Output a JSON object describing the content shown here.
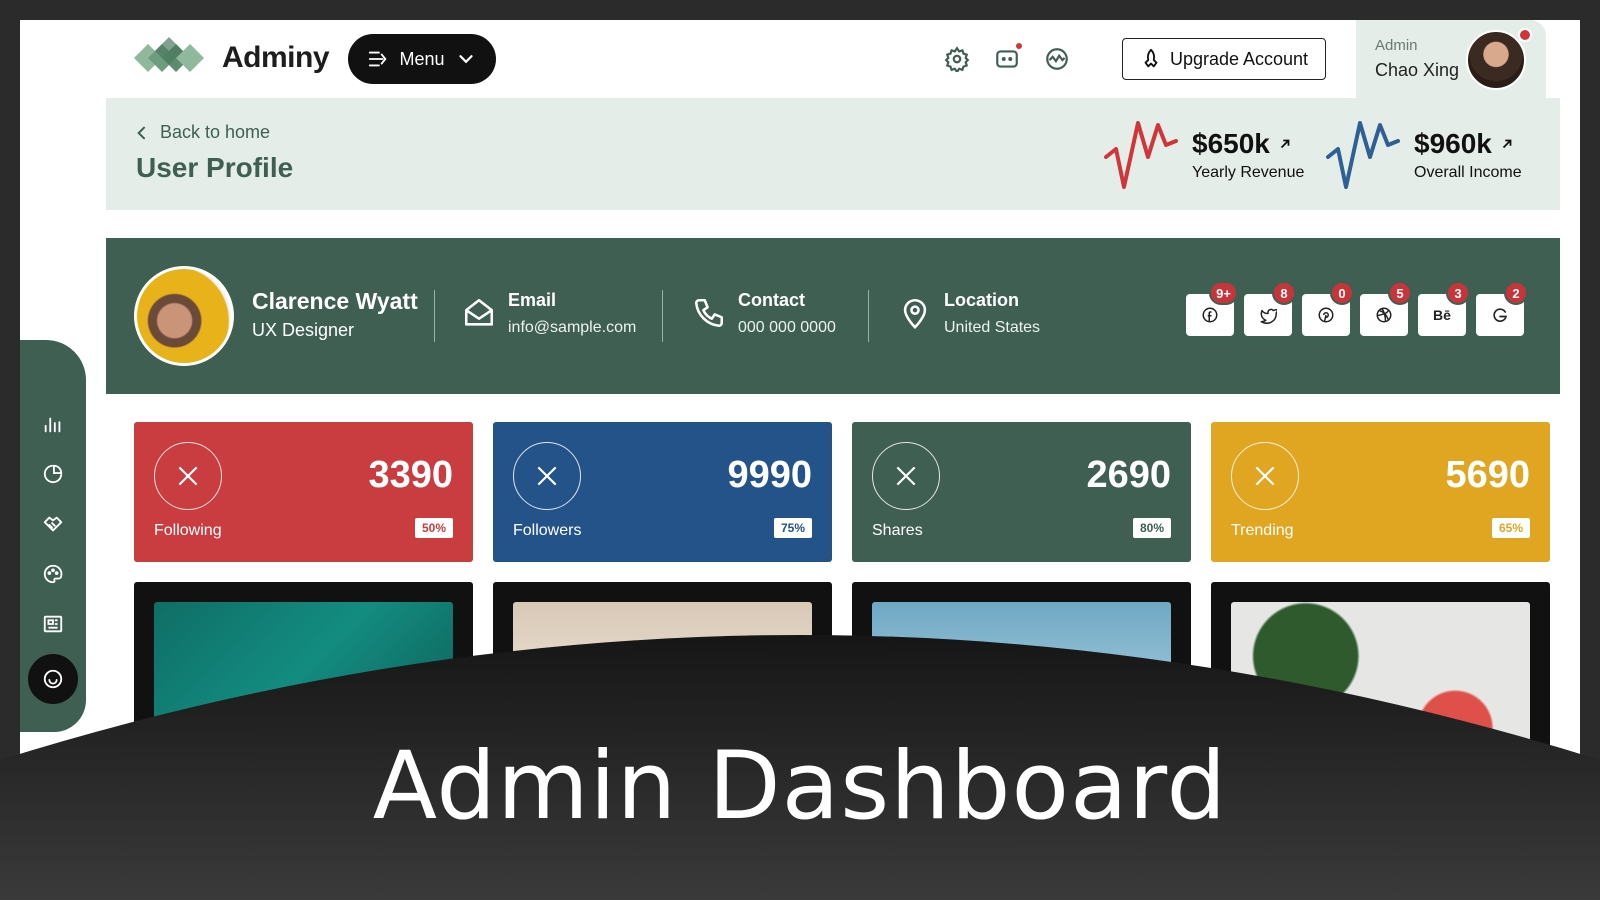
{
  "header": {
    "logo_text": "Adminy",
    "menu_label": "Menu",
    "upgrade_label": "Upgrade Account",
    "user": {
      "role": "Admin",
      "name": "Chao Xing"
    }
  },
  "subheader": {
    "back_label": "Back to home",
    "title": "User Profile",
    "stats": [
      {
        "value": "$650k",
        "label": "Yearly Revenue",
        "color": "#d0353a"
      },
      {
        "value": "$960k",
        "label": "Overall Income",
        "color": "#2e5f95"
      }
    ]
  },
  "profile": {
    "name": "Clarence Wyatt",
    "role": "UX Designer",
    "email": {
      "title": "Email",
      "value": "info@sample.com"
    },
    "contact": {
      "title": "Contact",
      "value": "000 000 0000"
    },
    "location": {
      "title": "Location",
      "value": "United States"
    },
    "social": [
      {
        "icon": "facebook-icon",
        "badge": "9+"
      },
      {
        "icon": "twitter-icon",
        "badge": "8"
      },
      {
        "icon": "pinterest-icon",
        "badge": "0"
      },
      {
        "icon": "dribbble-icon",
        "badge": "5"
      },
      {
        "icon": "behance-icon",
        "text": "Bē",
        "badge": "3"
      },
      {
        "icon": "google-icon",
        "badge": "2"
      }
    ]
  },
  "cards": [
    {
      "value": "3390",
      "label": "Following",
      "percent": "50%",
      "color": "#c93c40"
    },
    {
      "value": "9990",
      "label": "Followers",
      "percent": "75%",
      "color": "#24538a"
    },
    {
      "value": "2690",
      "label": "Shares",
      "percent": "80%",
      "color": "#3e5f52"
    },
    {
      "value": "5690",
      "label": "Trending",
      "percent": "65%",
      "color": "#e0a621"
    }
  ],
  "banner_title": "Admin Dashboard",
  "colors": {
    "primary": "#3e5f52",
    "light": "#e5ede8",
    "accent_red": "#d0353a"
  }
}
